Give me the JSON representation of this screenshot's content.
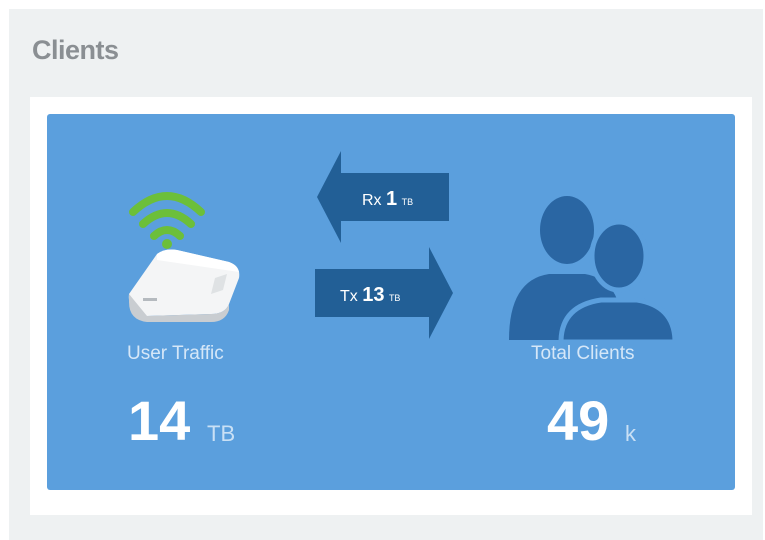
{
  "panel": {
    "title": "Clients"
  },
  "traffic": {
    "rx_label": "Rx",
    "rx_value": "1",
    "rx_unit": "TB",
    "tx_label": "Tx",
    "tx_value": "13",
    "tx_unit": "TB"
  },
  "user_traffic": {
    "label": "User Traffic",
    "value": "14",
    "unit": "TB"
  },
  "total_clients": {
    "label": "Total Clients",
    "value": "49",
    "unit": "k"
  },
  "colors": {
    "card_bg": "#5b9fdd",
    "arrow_bg": "#225f96",
    "wifi_green": "#6cbf3a",
    "clients_icon": "#2a66a3"
  },
  "icons": {
    "router": "access-point-icon",
    "wifi": "wifi-signal-icon",
    "clients": "users-icon"
  }
}
